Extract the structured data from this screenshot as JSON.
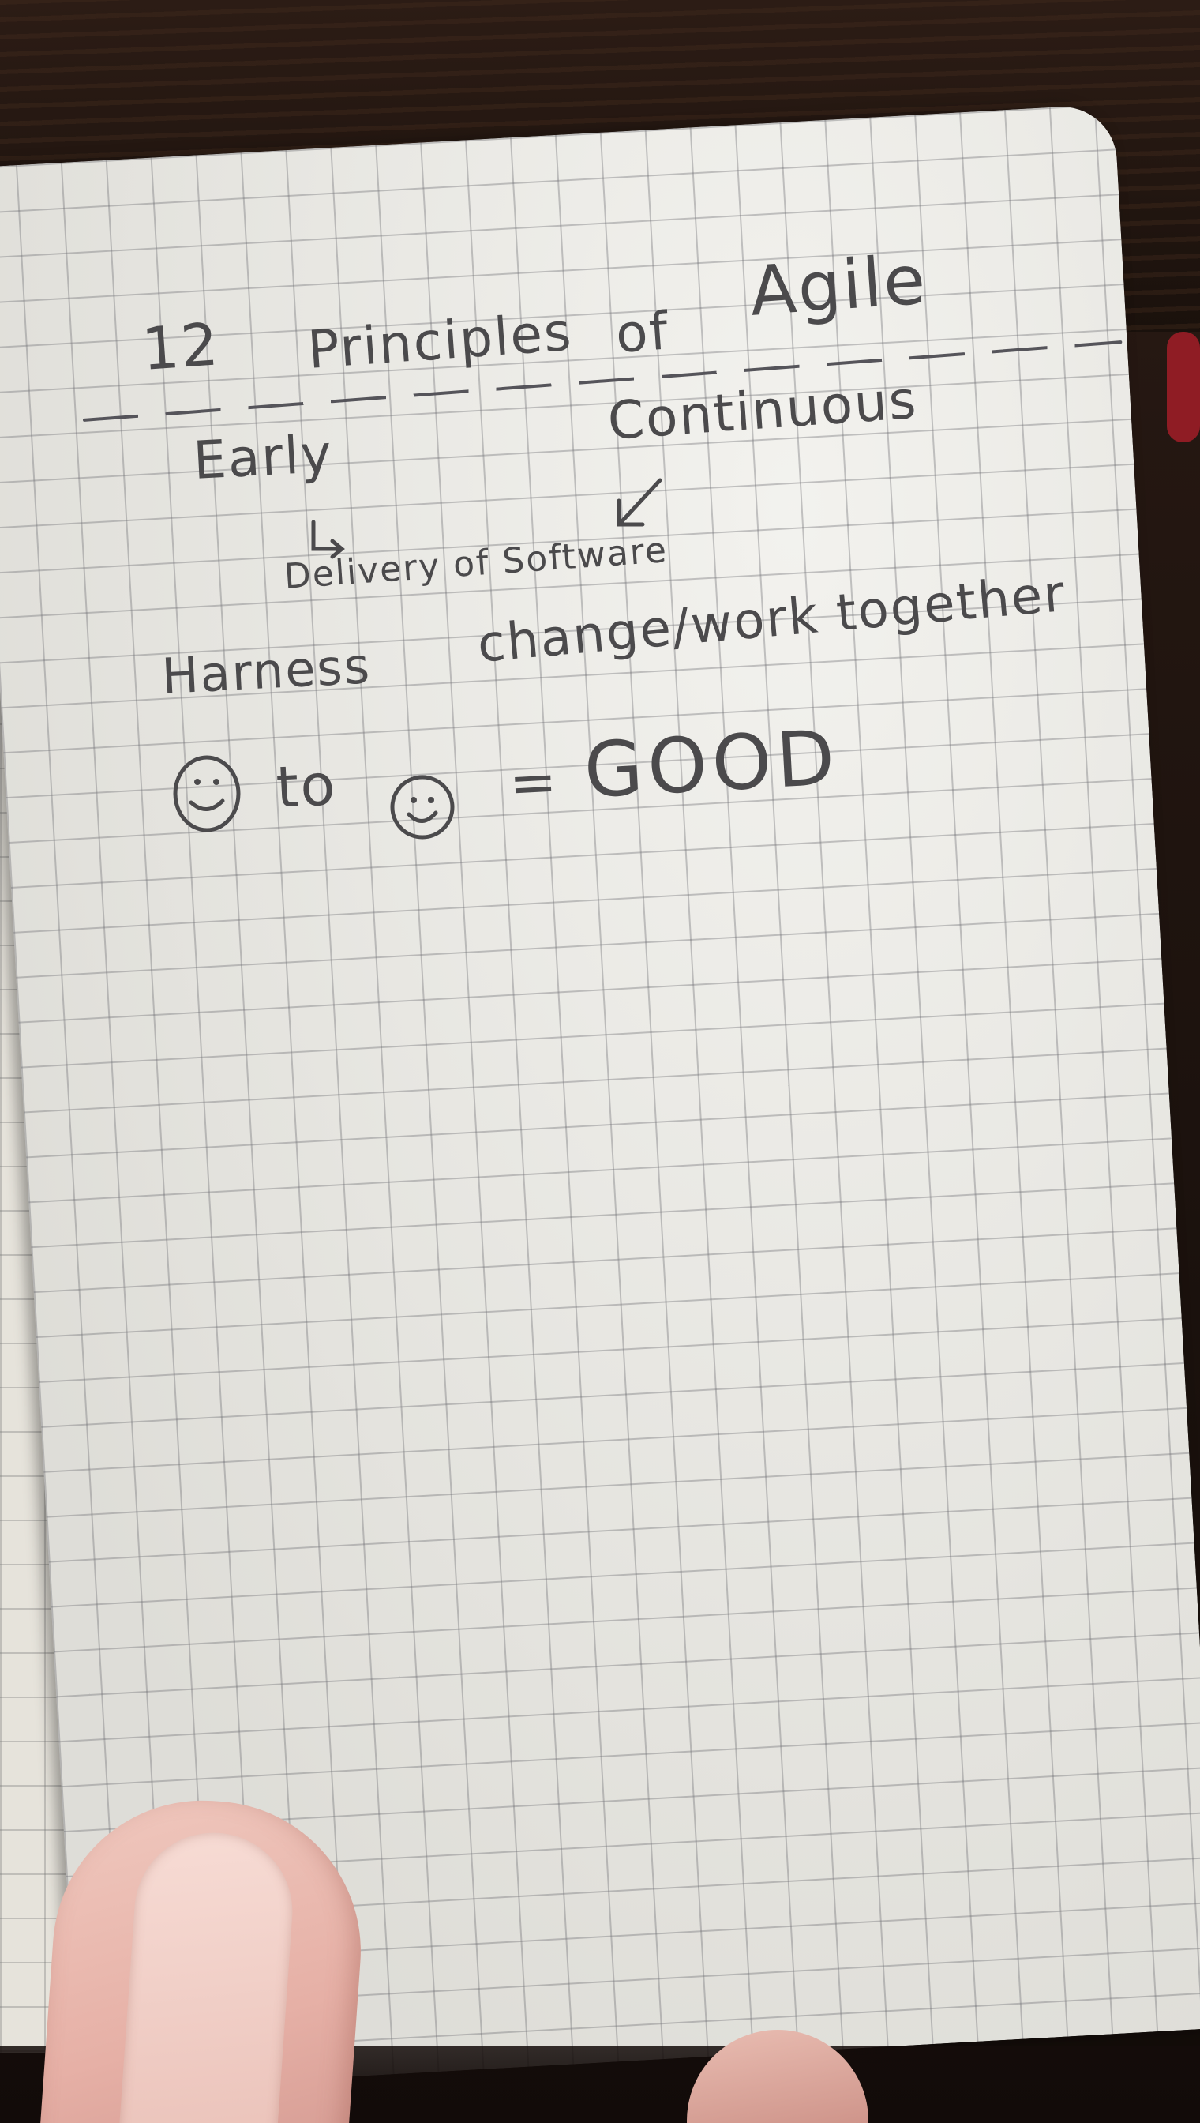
{
  "photo": {
    "subject": "handwritten notebook page on grid paper",
    "ink_color": "#4b4a4c",
    "paper_color": "#ecebe5",
    "grid_color": "#8a8a90",
    "background_color": "#1f140f",
    "ribbon_color": "#7a1d22",
    "skin_color": "#e6b0a6"
  },
  "notes": {
    "title": {
      "number": "12",
      "word1": "Principles",
      "word2": "of",
      "word3": "Agile"
    },
    "early": "Early",
    "continuous": "Continuous",
    "delivery": "Delivery of Software",
    "harness": "Harness",
    "change": "change/work together",
    "to": "to",
    "equals": "=",
    "good": "GOOD"
  },
  "icons": {
    "arrow_early": "down-right-arrow-icon",
    "arrow_continuous": "down-left-arrow-icon",
    "smiley": "smiley-face-icon"
  }
}
